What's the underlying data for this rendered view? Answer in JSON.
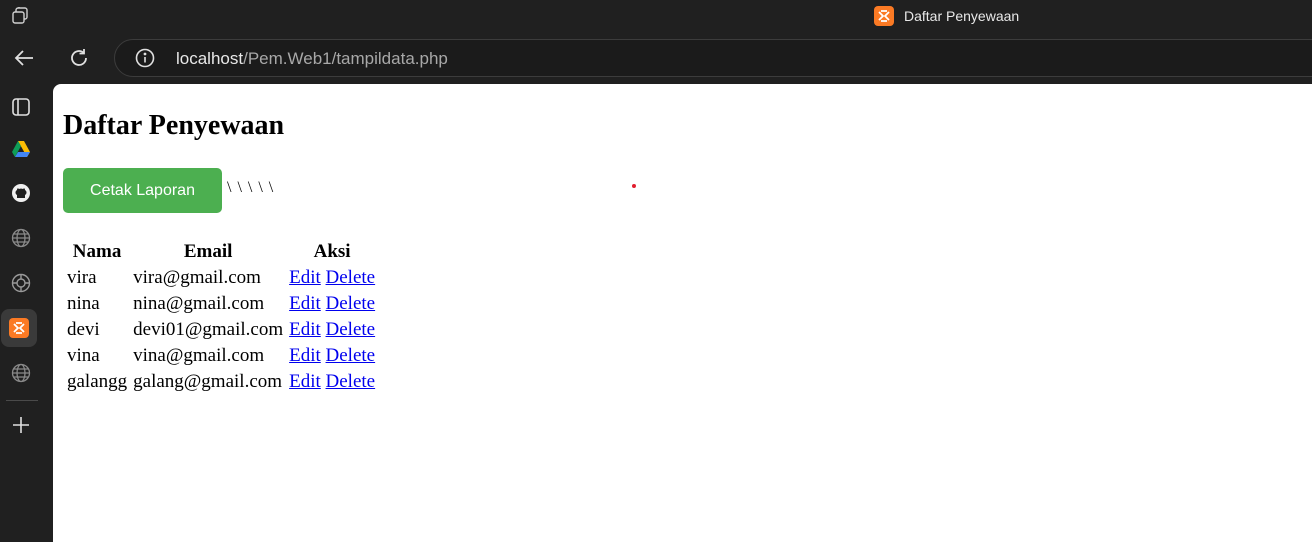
{
  "window": {
    "title": "Daftar Penyewaan"
  },
  "address_bar": {
    "host": "localhost",
    "path": "/Pem.Web1/tampildata.php"
  },
  "sidebar": {
    "icons": [
      "tab-actions-icon",
      "google-drive-icon",
      "github-icon",
      "globe-icon",
      "chatgpt-icon",
      "xampp-icon",
      "globe-icon",
      "add-icon"
    ]
  },
  "page": {
    "heading": "Daftar Penyewaan",
    "print_button_label": "Cetak Laporan",
    "stray_text": "\\ \\ \\ \\ \\",
    "table": {
      "headers": [
        "Nama",
        "Email",
        "Aksi"
      ],
      "rows": [
        {
          "nama": "vira",
          "email": "vira@gmail.com",
          "edit": "Edit",
          "delete": "Delete"
        },
        {
          "nama": "nina",
          "email": "nina@gmail.com",
          "edit": "Edit",
          "delete": "Delete"
        },
        {
          "nama": "devi",
          "email": "devi01@gmail.com",
          "edit": "Edit",
          "delete": "Delete"
        },
        {
          "nama": "vina",
          "email": "vina@gmail.com",
          "edit": "Edit",
          "delete": "Delete"
        },
        {
          "nama": "galangg",
          "email": "galang@gmail.com",
          "edit": "Edit",
          "delete": "Delete"
        }
      ]
    }
  },
  "colors": {
    "button_bg": "#4caf50",
    "link": "#0000ee",
    "xampp_brand": "#fb7a24"
  }
}
